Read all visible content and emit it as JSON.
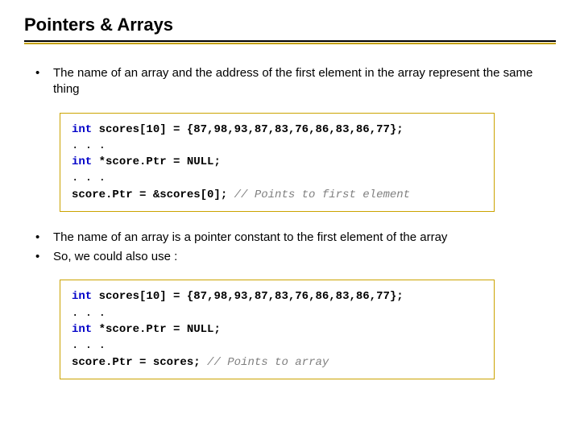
{
  "title": "Pointers & Arrays",
  "bullets": {
    "b1": "The name of an array and the address of the first element in the array represent the same thing",
    "b2": "The name of an array is a pointer constant to the first element of the array",
    "b3": "So, we could also use :"
  },
  "code1": {
    "l1_kw": "int",
    "l1_rest": " scores[10] = {87,98,93,87,83,76,86,83,86,77};",
    "ell": ". . .",
    "l2_kw": "int",
    "l2_rest": " *score.Ptr = NULL;",
    "l3": "score.Ptr = &scores[0];",
    "l3_cmt": "  // Points to first element"
  },
  "code2": {
    "l1_kw": "int",
    "l1_rest": " scores[10] = {87,98,93,87,83,76,86,83,86,77};",
    "ell": ". . .",
    "l2_kw": "int",
    "l2_rest": " *score.Ptr = NULL;",
    "l3": "score.Ptr = scores;",
    "l3_cmt": "    // Points to array"
  }
}
